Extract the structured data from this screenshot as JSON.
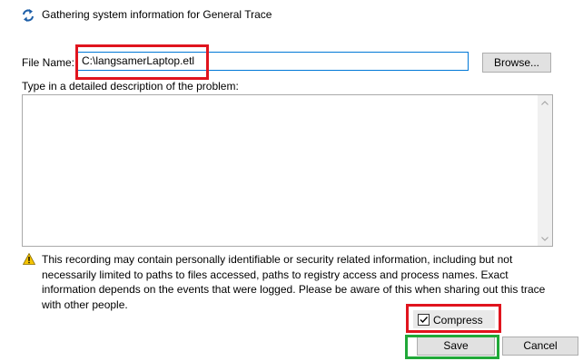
{
  "header": {
    "status_text": "Gathering system information for General Trace",
    "status_icon": "sync-arrows-icon"
  },
  "file_name": {
    "label": "File Name:",
    "value": "C:\\langsamerLaptop.etl",
    "browse_label": "Browse..."
  },
  "description": {
    "label": "Type in a detailed description of the problem:",
    "value": ""
  },
  "warning": {
    "icon": "warning-triangle-icon",
    "text": "This recording may contain personally identifiable or security related information, including but not necessarily limited to paths to files accessed, paths to registry access and process names. Exact information depends on the events that were logged. Please be aware of this when sharing out this trace with other people."
  },
  "compress": {
    "label": "Compress",
    "checked": true
  },
  "buttons": {
    "save_label": "Save",
    "cancel_label": "Cancel"
  },
  "colors": {
    "highlight_red": "#e0141e",
    "highlight_green": "#20a838",
    "focus_blue": "#0078d7"
  }
}
